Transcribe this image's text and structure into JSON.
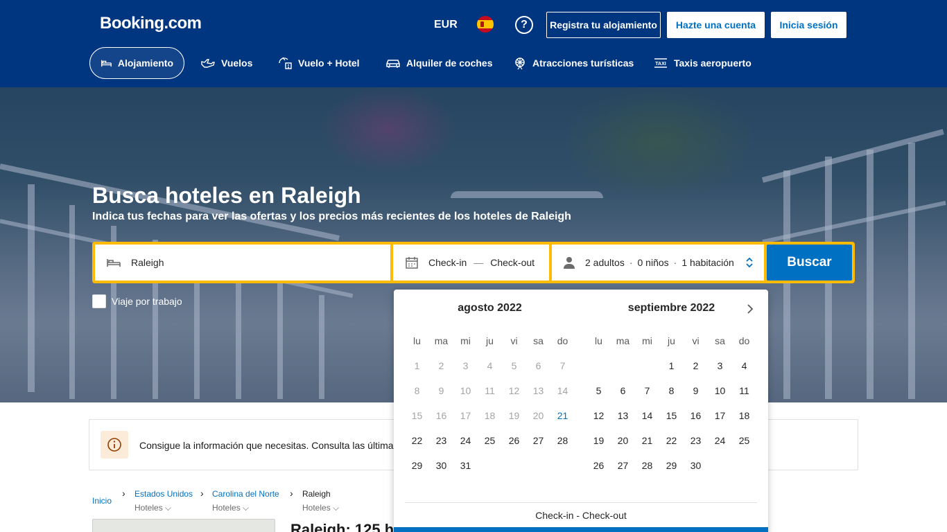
{
  "header": {
    "logo": "Booking.com",
    "currency": "EUR",
    "help": "?",
    "register_property": "Registra tu alojamiento",
    "create_account": "Hazte una cuenta",
    "sign_in": "Inicia sesión"
  },
  "nav": [
    {
      "label": "Alojamiento",
      "icon": "bed-icon",
      "active": true
    },
    {
      "label": "Vuelos",
      "icon": "plane-icon"
    },
    {
      "label": "Vuelo + Hotel",
      "icon": "plane-hotel-icon"
    },
    {
      "label": "Alquiler de coches",
      "icon": "car-icon"
    },
    {
      "label": "Atracciones turísticas",
      "icon": "attractions-icon"
    },
    {
      "label": "Taxis aeropuerto",
      "icon": "taxi-icon"
    }
  ],
  "hero": {
    "title": "Busca hoteles en Raleigh",
    "subtitle": "Indica tus fechas para ver las ofertas y los precios más recientes de los hoteles de Raleigh"
  },
  "search": {
    "destination": "Raleigh",
    "checkin": "Check-in",
    "dash": "—",
    "checkout": "Check-out",
    "adults": "2 adultos",
    "children": "0 niños",
    "rooms": "1 habitación",
    "separator": "·",
    "submit": "Buscar",
    "work_trip": "Viaje por trabajo"
  },
  "banner": {
    "text": "Consigue la información que necesitas. Consulta las últimas"
  },
  "breadcrumb": {
    "home": "Inicio",
    "items": [
      {
        "label": "Estados Unidos",
        "sub": "Hoteles ⌵"
      },
      {
        "label": "Carolina del Norte",
        "sub": "Hoteles ⌵"
      },
      {
        "label": "Raleigh",
        "sub": "Hoteles ⌵"
      }
    ]
  },
  "results_title": "Raleigh: 125 h",
  "calendar": {
    "weekdays": [
      "lu",
      "ma",
      "mi",
      "ju",
      "vi",
      "sa",
      "do"
    ],
    "months": [
      {
        "title": "agosto 2022",
        "weeks": [
          [
            "1",
            "2",
            "3",
            "4",
            "5",
            "6",
            "7"
          ],
          [
            "8",
            "9",
            "10",
            "11",
            "12",
            "13",
            "14"
          ],
          [
            "15",
            "16",
            "17",
            "18",
            "19",
            "20",
            "21"
          ],
          [
            "22",
            "23",
            "24",
            "25",
            "26",
            "27",
            "28"
          ],
          [
            "29",
            "30",
            "31",
            "",
            "",
            "",
            ""
          ]
        ]
      },
      {
        "title": "septiembre 2022",
        "weeks": [
          [
            "",
            "",
            "",
            "1",
            "2",
            "3",
            "4"
          ],
          [
            "5",
            "6",
            "7",
            "8",
            "9",
            "10",
            "11"
          ],
          [
            "12",
            "13",
            "14",
            "15",
            "16",
            "17",
            "18"
          ],
          [
            "19",
            "20",
            "21",
            "22",
            "23",
            "24",
            "25"
          ],
          [
            "26",
            "27",
            "28",
            "29",
            "30",
            "",
            ""
          ]
        ]
      }
    ],
    "today": "21",
    "footer": "Check-in - Check-out"
  },
  "colors": {
    "brand": "#003580",
    "accent": "#0071c2",
    "search_border": "#febb02"
  }
}
